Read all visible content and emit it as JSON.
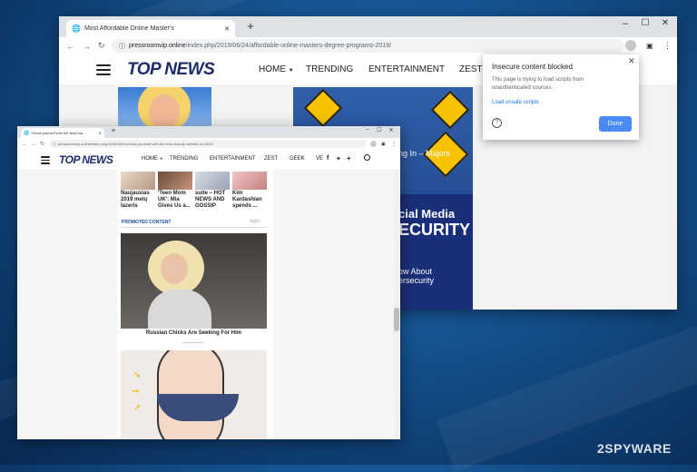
{
  "back_window": {
    "tab_title": "Most Affordable Online Master's",
    "url_domain": "pressroomvip.online",
    "url_path": "/index.php/2019/06/24/affordable-online-masters-degree-programs-2019/",
    "logo": "TOP NEWS",
    "nav": [
      "HOME",
      "TRENDING",
      "ENTERTAINMENT",
      "ZEST"
    ],
    "article_text_1": "ng In – Majors",
    "article_text_2_line1": "cial Media",
    "article_text_2_line2": "ECURITY",
    "article_text_3_line1": "ow About",
    "article_text_3_line2": "ersecurity"
  },
  "popup": {
    "title": "Insecure content blocked",
    "body": "This page is trying to load scripts from unauthenticated sources.",
    "link": "Load unsafe scripts",
    "done": "Done"
  },
  "front_window": {
    "tab_title": "Check yourself with the best bra...",
    "url": "pressroomvip.online/index.php/2019/06/21/check-yourself-with-the-best-beauty-website-of-2019/",
    "logo": "TOP NEWS",
    "nav": [
      "HOME",
      "TRENDING",
      "ENTERTAINMENT",
      "ZEST",
      "GEEK",
      "VE"
    ],
    "thumbs": [
      {
        "caption": "Naujausias 2019 metų lazeris"
      },
      {
        "caption": "'Teen Mom UK': Mia Gives Us a..."
      },
      {
        "caption": "suite – HOT NEWS AND GOSSIP"
      },
      {
        "caption": "Kim Kardashian spends ..."
      }
    ],
    "promoted": "PROMOTED CONTENT",
    "mgid": "mgid",
    "ad_caption": "Russian Chicks Are Seeking For Him"
  },
  "watermark": "2SPYWARE",
  "colors": {
    "desktop": "#165493",
    "logo": "#1d2d6b",
    "popup_button": "#4a8af4",
    "promoted": "#1a4fa0",
    "sign": "#f7c200"
  }
}
